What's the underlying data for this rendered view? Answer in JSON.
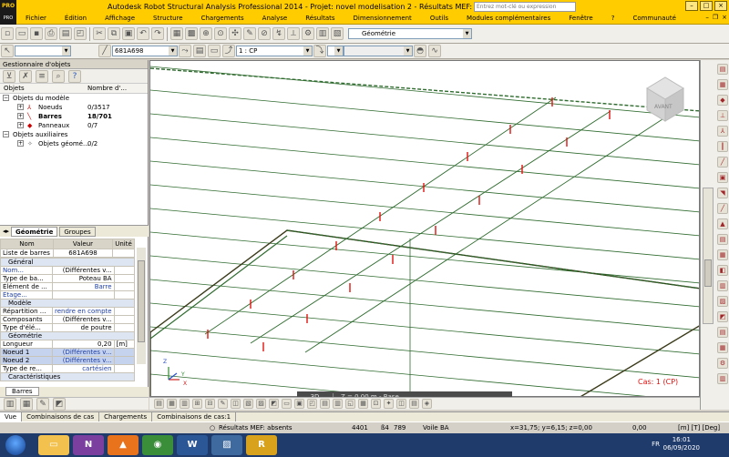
{
  "window": {
    "title": "Autodesk Robot Structural Analysis Professional 2014 - Projet: novel modelisation 2 - Résultats MEF: absents",
    "search_placeholder": "Entrez mot-clé ou expression",
    "logo_text": "PRO"
  },
  "menu": [
    "Fichier",
    "Édition",
    "Affichage",
    "Structure",
    "Chargements",
    "Analyse",
    "Résultats",
    "Dimensionnement",
    "Outils",
    "Modules complémentaires",
    "Fenêtre",
    "?",
    "Communauté"
  ],
  "toolbar": {
    "view_combo": "Géométrie",
    "selection_combo": "681A698",
    "case_combo": "1 : CP"
  },
  "inspector": {
    "header": "Gestionnaire d'objets",
    "col_objects": "Objets",
    "col_count": "Nombre d'...",
    "tree": [
      {
        "label": "Objets du modèle",
        "value": ""
      },
      {
        "label": "Noeuds",
        "value": "0/3517"
      },
      {
        "label": "Barres",
        "value": "18/701"
      },
      {
        "label": "Panneaux",
        "value": "0/7"
      },
      {
        "label": "Objets auxiliaires",
        "value": ""
      },
      {
        "label": "Objets géomé...",
        "value": "0/2"
      }
    ],
    "tab_geometry": "Géométrie",
    "tab_groups": "Groupes"
  },
  "properties": {
    "col_name": "Nom",
    "col_value": "Valeur",
    "col_unit": "Unité",
    "list_label": "Liste de barres",
    "list_value": "681A698",
    "rows": [
      {
        "name": "Général",
        "value": "",
        "unit": "",
        "kind": "sec"
      },
      {
        "name": "Nom...",
        "value": "(Différentes v...",
        "unit": "",
        "kind": "blue"
      },
      {
        "name": "Type de ba...",
        "value": "Poteau BA",
        "unit": "",
        "kind": ""
      },
      {
        "name": "Élément de ...",
        "value": "Barre",
        "unit": "",
        "kind": "blueval"
      },
      {
        "name": "Étage...",
        "value": "",
        "unit": "",
        "kind": "blue"
      },
      {
        "name": "Modèle",
        "value": "",
        "unit": "",
        "kind": "sec"
      },
      {
        "name": "Répartition ...",
        "value": "rendre en compte",
        "unit": "",
        "kind": "blueval"
      },
      {
        "name": "Composants",
        "value": "(Différentes v...",
        "unit": "",
        "kind": ""
      },
      {
        "name": "Type d'élé...",
        "value": "de poutre",
        "unit": "",
        "kind": ""
      },
      {
        "name": "Géométrie",
        "value": "",
        "unit": "",
        "kind": "sec"
      },
      {
        "name": "Longueur",
        "value": "0,20",
        "unit": "[m]",
        "kind": ""
      },
      {
        "name": "Noeud 1",
        "value": "(Différentes v...",
        "unit": "",
        "kind": "hi"
      },
      {
        "name": "Noeud 2",
        "value": "(Différentes v...",
        "unit": "",
        "kind": "hi"
      },
      {
        "name": "Type de re...",
        "value": "cartésien",
        "unit": "",
        "kind": "blueval"
      },
      {
        "name": "Caractéristiques",
        "value": "",
        "unit": "",
        "kind": "sec"
      }
    ],
    "bottom_tab": "Barres"
  },
  "viewport": {
    "mode_button": "3D",
    "z_level": "Z = 0,00 m - Base",
    "case_label": "Cas: 1 (CP)",
    "viewcube_label": "AVANT",
    "axis_x": "X",
    "axis_y": "Y",
    "axis_z": "Z"
  },
  "bottom_tabs": [
    "Vue",
    "Combinaisons de cas",
    "Chargements",
    "Combinaisons de cas:1"
  ],
  "status": {
    "results": "Résultats MEF: absents",
    "num1": "4401",
    "num2": "789",
    "element": "Voile BA",
    "coords": "x=31,75; y=6,15; z=0,00",
    "angle": "0,00",
    "units": "[m] [T] [Deg]"
  },
  "taskbar": {
    "lang": "FR",
    "time": "16:01",
    "date": "06/09/2020"
  },
  "colors": {
    "robot_yellow": "#ffcc00",
    "structure_green": "#2f6b2f",
    "column_red": "#e0120f",
    "taskbar_blue": "#1f3b6b"
  }
}
